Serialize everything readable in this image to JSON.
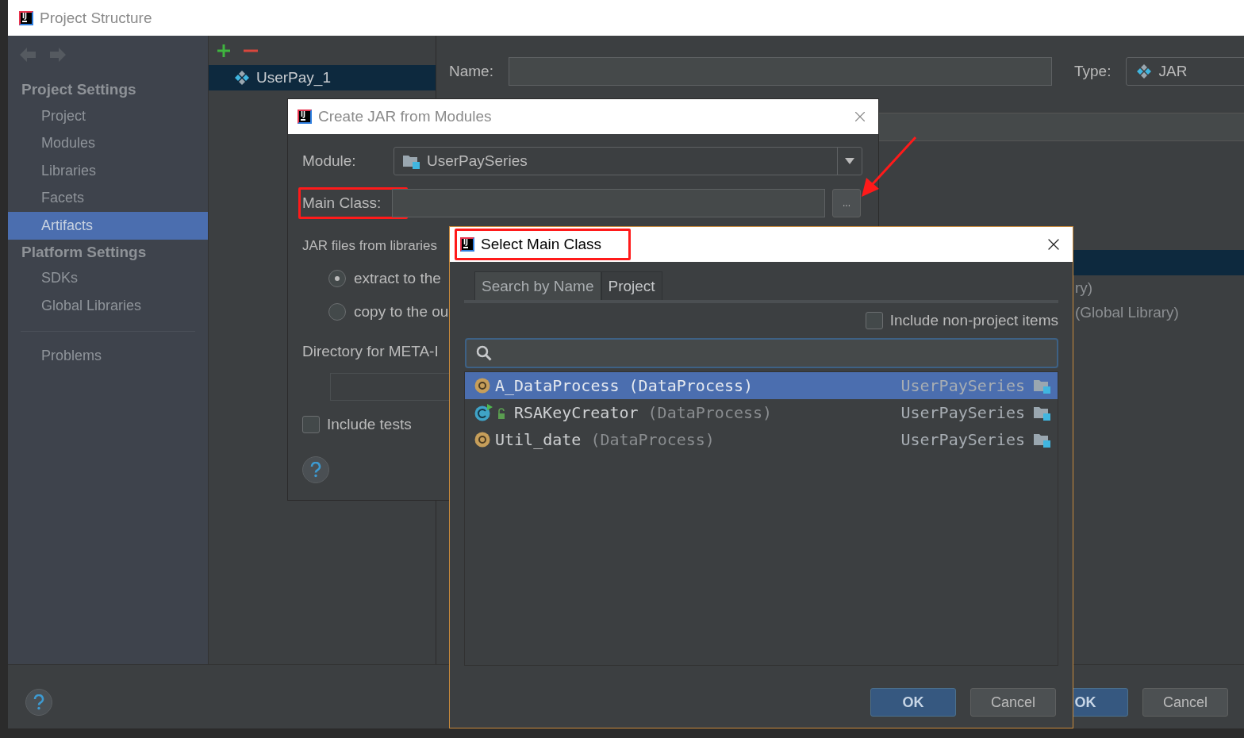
{
  "project_structure": {
    "title": "Project Structure",
    "icon_text": "IJ",
    "sidebar": [
      {
        "heading": "Project Settings",
        "items": [
          {
            "label": "Project",
            "selected": false
          },
          {
            "label": "Modules",
            "selected": false
          },
          {
            "label": "Libraries",
            "selected": false
          },
          {
            "label": "Facets",
            "selected": false
          },
          {
            "label": "Artifacts",
            "selected": true
          }
        ]
      },
      {
        "heading": "Platform Settings",
        "items": [
          {
            "label": "SDKs",
            "selected": false
          },
          {
            "label": "Global Libraries",
            "selected": false
          }
        ]
      },
      {
        "items": [
          {
            "label": "Problems",
            "selected": false
          }
        ]
      }
    ],
    "artifacts": [
      {
        "name": "UserPay_1",
        "selected": true
      }
    ],
    "name_label": "Name:",
    "type_label": "Type:",
    "type_value": "JAR",
    "tree_fragments": [
      "ry)",
      "(Global Library)"
    ],
    "buttons": [
      {
        "label": "OK",
        "kind": "primary"
      },
      {
        "label": "Cancel",
        "kind": "secondary"
      }
    ]
  },
  "create_jar": {
    "title": "Create JAR from Modules",
    "icon_text": "IJ",
    "module_label": "Module:",
    "module_value": "UserPaySeries",
    "main_class_label": "Main Class:",
    "main_class_highlighted": true,
    "browse_label": "...",
    "browse_pointed_at": true,
    "jar_files_label": "JAR files from libraries",
    "options": [
      {
        "label": "extract to the",
        "selected": true
      },
      {
        "label": "copy to the ou",
        "selected": false
      }
    ],
    "directory_label": "Directory for META-I",
    "include_tests": {
      "label": "Include tests",
      "checked": false
    }
  },
  "select_main_class": {
    "title": "Select Main Class",
    "icon_text": "IJ",
    "title_highlighted": true,
    "tabs": [
      {
        "label": "Search by Name",
        "selected": true
      },
      {
        "label": "Project",
        "selected": false
      }
    ],
    "include_non_project": {
      "label": "Include non-project items",
      "checked": false
    },
    "results": [
      {
        "name": "A_DataProcess",
        "package": "(DataProcess)",
        "module": "UserPaySeries",
        "kind": "class",
        "selected": true
      },
      {
        "name": "RSAKeyCreator",
        "package": "(DataProcess)",
        "module": "UserPaySeries",
        "kind": "runnable",
        "selected": false
      },
      {
        "name": "Util_date",
        "package": "(DataProcess)",
        "module": "UserPaySeries",
        "kind": "class",
        "selected": false
      }
    ],
    "buttons": [
      {
        "label": "OK",
        "kind": "primary"
      },
      {
        "label": "Cancel",
        "kind": "secondary"
      }
    ]
  }
}
